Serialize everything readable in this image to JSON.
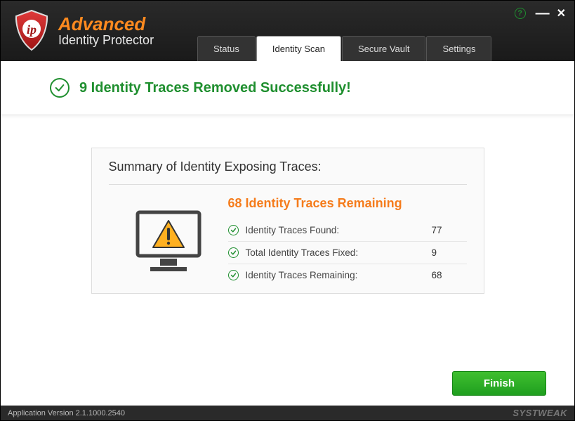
{
  "brand": {
    "top": "Advanced",
    "bottom": "Identity Protector"
  },
  "tabs": {
    "status": "Status",
    "identity_scan": "Identity Scan",
    "secure_vault": "Secure Vault",
    "settings": "Settings"
  },
  "banner": {
    "message": "9 Identity Traces Removed Successfully!"
  },
  "summary": {
    "title": "Summary of Identity Exposing Traces:",
    "remaining_headline": "68 Identity Traces Remaining",
    "rows": {
      "found_label": "Identity Traces Found:",
      "found_value": "77",
      "fixed_label": "Total Identity Traces Fixed:",
      "fixed_value": "9",
      "remaining_label": "Identity Traces Remaining:",
      "remaining_value": "68"
    }
  },
  "actions": {
    "finish": "Finish"
  },
  "statusbar": {
    "version": "Application Version 2.1.1000.2540",
    "vendor": "SYSTWEAK"
  }
}
